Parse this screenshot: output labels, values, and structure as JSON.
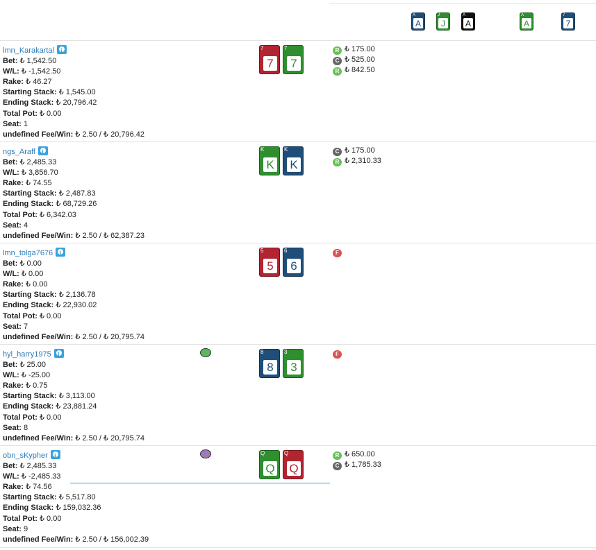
{
  "currency": "₺",
  "board": [
    {
      "rank": "A",
      "color": "blue"
    },
    {
      "rank": "J",
      "color": "green"
    },
    {
      "rank": "A",
      "color": "black"
    },
    {
      "rank": "A",
      "color": "green"
    },
    {
      "rank": "7",
      "color": "blue"
    }
  ],
  "players": [
    {
      "name": "lmn_Karakartal",
      "bet": "₺ 1,542.50",
      "wl": "₺ -1,542.50",
      "rake": "₺ 46.27",
      "starting": "₺ 1,545.00",
      "ending": "₺ 20,796.42",
      "pot": "₺ 0.00",
      "seat": "1",
      "fee": "₺ 2.50 / ₺ 20,796.42",
      "cards": [
        {
          "rank": "7",
          "color": "red"
        },
        {
          "rank": "7",
          "color": "green"
        }
      ],
      "chip": "",
      "actions": [
        {
          "type": "R",
          "amount": "₺ 175.00"
        },
        {
          "type": "C",
          "amount": "₺ 525.00"
        },
        {
          "type": "R",
          "amount": "₺ 842.50"
        }
      ]
    },
    {
      "name": "ngs_Araff",
      "bet": "₺ 2,485.33",
      "wl": "₺ 3,856.70",
      "rake": "₺ 74.55",
      "starting": "₺ 2,487.83",
      "ending": "₺ 68,729.26",
      "pot": "₺ 6,342.03",
      "seat": "4",
      "fee": "₺ 2.50 / ₺ 62,387.23",
      "cards": [
        {
          "rank": "K",
          "color": "green"
        },
        {
          "rank": "K",
          "color": "blue"
        }
      ],
      "chip": "",
      "actions": [
        {
          "type": "C",
          "amount": "₺ 175.00"
        },
        {
          "type": "R",
          "amount": "₺ 2,310.33"
        }
      ]
    },
    {
      "name": "lmn_tolga7676",
      "bet": "₺ 0.00",
      "wl": "₺ 0.00",
      "rake": "₺ 0.00",
      "starting": "₺ 2,136.78",
      "ending": "₺ 22,930.02",
      "pot": "₺ 0.00",
      "seat": "7",
      "fee": "₺ 2.50 / ₺ 20,795.74",
      "cards": [
        {
          "rank": "5",
          "color": "red"
        },
        {
          "rank": "6",
          "color": "blue"
        }
      ],
      "chip": "",
      "actions": [
        {
          "type": "F",
          "amount": ""
        }
      ]
    },
    {
      "name": "hyl_harry1975",
      "bet": "₺ 25.00",
      "wl": "₺ -25.00",
      "rake": "₺ 0.75",
      "starting": "₺ 3,113.00",
      "ending": "₺ 23,881.24",
      "pot": "₺ 0.00",
      "seat": "8",
      "fee": "₺ 2.50 / ₺ 20,795.74",
      "cards": [
        {
          "rank": "8",
          "color": "blue"
        },
        {
          "rank": "3",
          "color": "green"
        }
      ],
      "chip": "green",
      "actions": [
        {
          "type": "F",
          "amount": ""
        }
      ]
    },
    {
      "name": "obn_sKypher",
      "bet": "₺ 2,485.33",
      "wl": "₺ -2,485.33",
      "rake": "₺ 74.56",
      "starting": "₺ 5,517.80",
      "ending": "₺ 159,032.36",
      "pot": "₺ 0.00",
      "seat": "9",
      "fee": "₺ 2.50 / ₺ 156,002.39",
      "cards": [
        {
          "rank": "Q",
          "color": "green"
        },
        {
          "rank": "Q",
          "color": "red"
        }
      ],
      "chip": "purple",
      "actions": [
        {
          "type": "R",
          "amount": "₺ 650.00"
        },
        {
          "type": "C",
          "amount": "₺ 1,785.33"
        }
      ]
    }
  ],
  "labels": {
    "bet": "Bet:",
    "wl": "W/L:",
    "rake": "Rake:",
    "starting": "Starting Stack:",
    "ending": "Ending Stack:",
    "pot": "Total Pot:",
    "seat": "Seat:",
    "fee": "undefined Fee/Win:"
  }
}
